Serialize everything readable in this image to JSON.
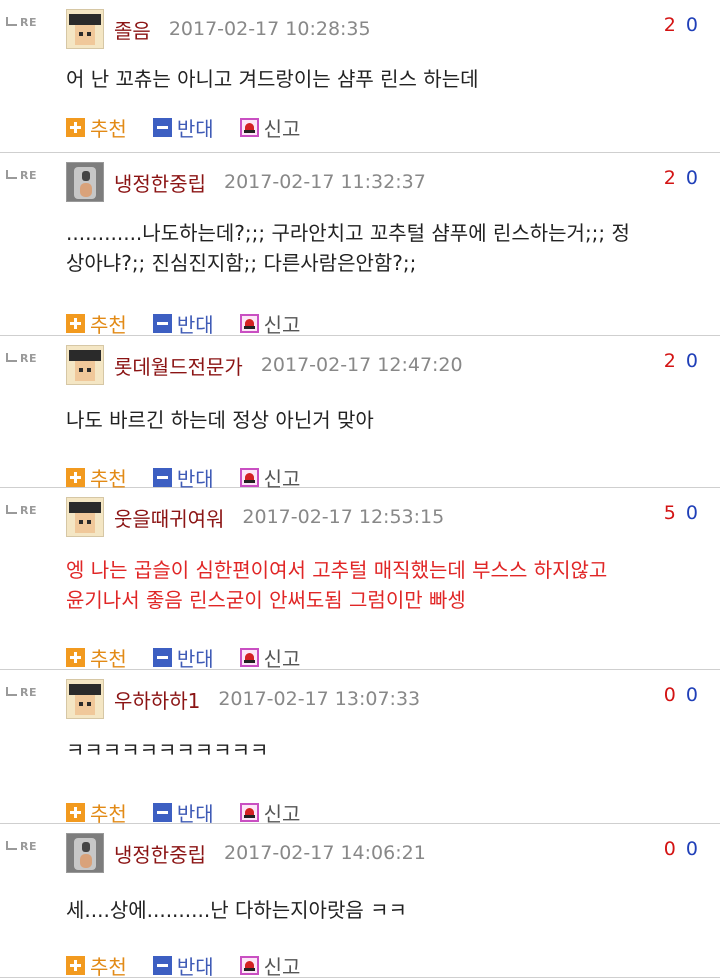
{
  "re_label": "RE",
  "actions": {
    "recommend": "추천",
    "oppose": "반대",
    "report": "신고"
  },
  "colors": {
    "nickname": "#8b1414",
    "highlight_text": "#e02626",
    "up_score": "#d31313",
    "down_score": "#1f3fb8"
  },
  "comments": [
    {
      "nickname": "졸음",
      "date": "2017-02-17 10:28:35",
      "up": "2",
      "down": "0",
      "lines": [
        "어 난 꼬츄는 아니고 겨드랑이는 샴푸 린스 하는데"
      ],
      "avatar": "pixel-face-icon"
    },
    {
      "nickname": "냉정한중립",
      "date": "2017-02-17 11:32:37",
      "up": "2",
      "down": "0",
      "lines": [
        "............나도하는데?;;; 구라안치고 꼬추털 샴푸에 린스하는거;;; 정",
        "상아냐?;; 진심진지함;; 다른사람은안함?;;"
      ],
      "avatar": "photo-avatar"
    },
    {
      "nickname": "롯데월드전문가",
      "date": "2017-02-17 12:47:20",
      "up": "2",
      "down": "0",
      "lines": [
        "나도 바르긴 하는데 정상 아닌거 맞아"
      ],
      "avatar": "pixel-face-icon"
    },
    {
      "nickname": "웃을때귀여워",
      "date": "2017-02-17 12:53:15",
      "up": "5",
      "down": "0",
      "lines": [
        "엥 나는 곱슬이 심한편이여서 고추털 매직했는데 부스스 하지않고",
        "윤기나서 좋음 린스굳이 안써도됨 그럼이만 빠셍"
      ],
      "avatar": "pixel-face-icon",
      "red": true
    },
    {
      "nickname": "우하하하1",
      "date": "2017-02-17 13:07:33",
      "up": "0",
      "down": "0",
      "lines": [
        "ㅋㅋㅋㅋㅋㅋㅋㅋㅋㅋㅋ"
      ],
      "avatar": "pixel-face-icon"
    },
    {
      "nickname": "냉정한중립",
      "date": "2017-02-17 14:06:21",
      "up": "0",
      "down": "0",
      "lines": [
        "세....상에..........난 다하는지아랏음 ㅋㅋ"
      ],
      "avatar": "photo-avatar"
    }
  ]
}
